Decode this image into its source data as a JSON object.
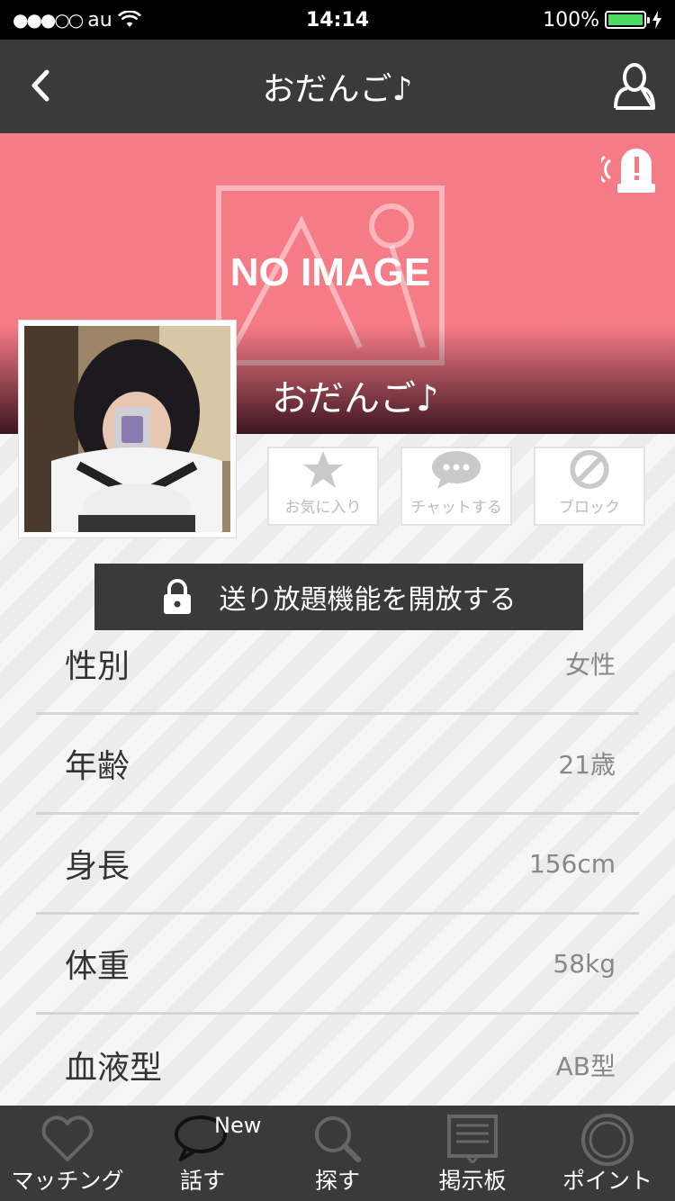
{
  "status_bar": {
    "signal": "●●●○○",
    "carrier": "au",
    "time": "14:14",
    "battery": "100%"
  },
  "nav": {
    "title": "おだんご♪"
  },
  "hero": {
    "no_image_text": "NO IMAGE",
    "name": "おだんご♪",
    "background_color": "#f57b86"
  },
  "actions": [
    {
      "label": "お気に入り",
      "icon": "star-icon"
    },
    {
      "label": "チャットする",
      "icon": "chat-bubble-icon"
    },
    {
      "label": "ブロック",
      "icon": "block-icon"
    }
  ],
  "unlock_button": {
    "label": "送り放題機能を開放する",
    "icon": "lock-icon"
  },
  "profile": [
    {
      "label": "性別",
      "value": "女性"
    },
    {
      "label": "年齢",
      "value": "21歳"
    },
    {
      "label": "身長",
      "value": "156cm"
    },
    {
      "label": "体重",
      "value": "58kg"
    },
    {
      "label": "血液型",
      "value": "AB型"
    }
  ],
  "tabs": [
    {
      "label": "マッチング",
      "icon": "heart-icon"
    },
    {
      "label": "話す",
      "icon": "speech-bubble-icon",
      "badge": "New"
    },
    {
      "label": "探す",
      "icon": "magnifier-icon"
    },
    {
      "label": "掲示板",
      "icon": "bulletin-board-icon"
    },
    {
      "label": "ポイント",
      "icon": "coin-icon"
    }
  ]
}
